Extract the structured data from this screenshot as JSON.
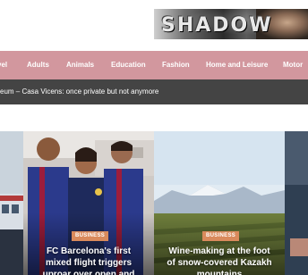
{
  "banner": {
    "title": "SHADOW"
  },
  "nav": {
    "items": [
      {
        "label": "vel"
      },
      {
        "label": "Adults"
      },
      {
        "label": "Animals"
      },
      {
        "label": "Education"
      },
      {
        "label": "Fashion"
      },
      {
        "label": "Home and Leisure"
      },
      {
        "label": "Motor"
      }
    ],
    "background": "#d2979e"
  },
  "ticker": {
    "text": "eum – Casa Vicens: once private but not anymore",
    "background": "#444444"
  },
  "cards": [
    {
      "badge": "BUSINESS",
      "title": "FC Barcelona's first mixed flight triggers uproar over open and"
    },
    {
      "badge": "BUSINESS",
      "title": "Wine-making at the foot of snow-covered Kazakh mountains"
    }
  ],
  "colors": {
    "badge": "#d98a5c"
  }
}
